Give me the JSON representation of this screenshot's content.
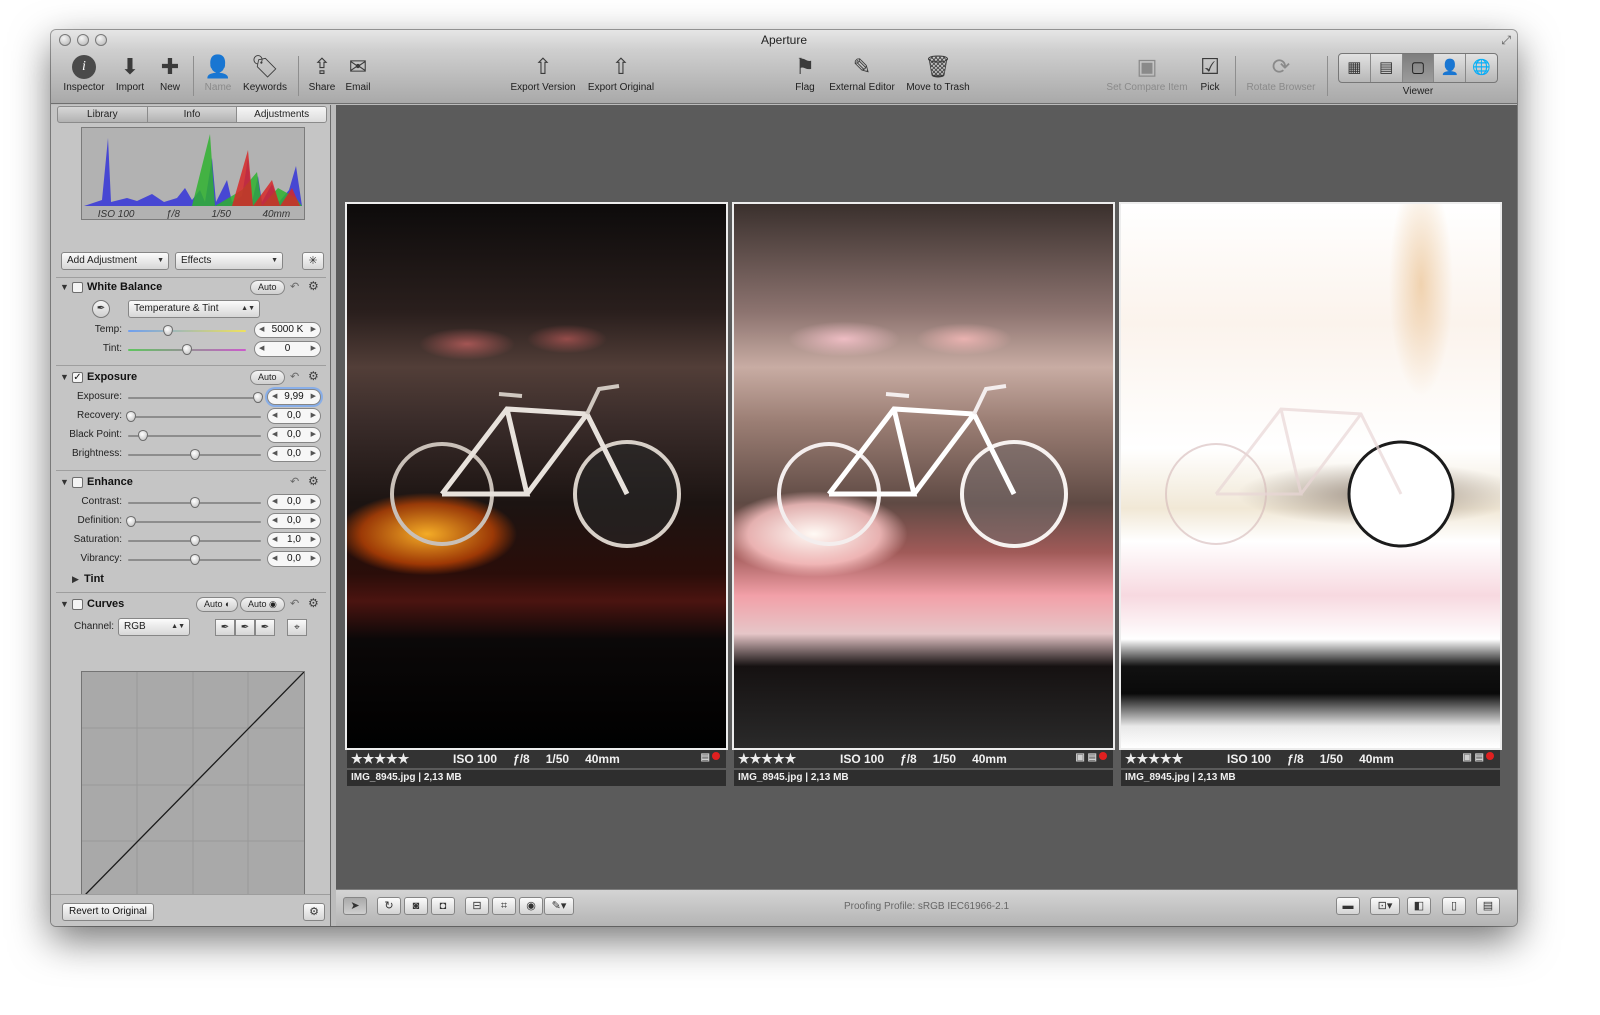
{
  "window": {
    "title": "Aperture"
  },
  "toolbar": {
    "inspector": "Inspector",
    "import": "Import",
    "new": "New",
    "name": "Name",
    "keywords": "Keywords",
    "share": "Share",
    "email": "Email",
    "export_version": "Export Version",
    "export_original": "Export Original",
    "flag": "Flag",
    "external_editor": "External Editor",
    "move_to_trash": "Move to Trash",
    "set_compare_item": "Set Compare Item",
    "pick": "Pick",
    "rotate_browser": "Rotate Browser",
    "viewer": "Viewer"
  },
  "inspector": {
    "tabs": [
      "Library",
      "Info",
      "Adjustments"
    ],
    "active_tab": "Adjustments",
    "histogram": {
      "iso": "ISO 100",
      "aperture": "ƒ/8",
      "shutter": "1/50",
      "focal": "40mm"
    },
    "add_adjustment": "Add Adjustment",
    "effects": "Effects",
    "white_balance": {
      "title": "White Balance",
      "enabled": false,
      "auto": "Auto",
      "mode": "Temperature & Tint",
      "temp_label": "Temp:",
      "temp_value": "5000 K",
      "tint_label": "Tint:",
      "tint_value": "0"
    },
    "exposure": {
      "title": "Exposure",
      "enabled": true,
      "auto": "Auto",
      "rows": [
        {
          "label": "Exposure:",
          "value": "9,99"
        },
        {
          "label": "Recovery:",
          "value": "0,0"
        },
        {
          "label": "Black Point:",
          "value": "0,0"
        },
        {
          "label": "Brightness:",
          "value": "0,0"
        }
      ]
    },
    "enhance": {
      "title": "Enhance",
      "enabled": false,
      "rows": [
        {
          "label": "Contrast:",
          "value": "0,0"
        },
        {
          "label": "Definition:",
          "value": "0,0"
        },
        {
          "label": "Saturation:",
          "value": "1,0"
        },
        {
          "label": "Vibrancy:",
          "value": "0,0"
        }
      ],
      "tint": "Tint"
    },
    "curves": {
      "title": "Curves",
      "enabled": false,
      "auto1": "Auto",
      "auto2": "Auto",
      "channel_label": "Channel:",
      "channel_value": "RGB"
    },
    "revert": "Revert to Original"
  },
  "images": [
    {
      "rating": "★★★★★",
      "iso": "ISO 100",
      "aperture": "ƒ/8",
      "shutter": "1/50",
      "focal": "40mm",
      "file": "IMG_8945.jpg",
      "size": "2,13 MB"
    },
    {
      "rating": "★★★★★",
      "iso": "ISO 100",
      "aperture": "ƒ/8",
      "shutter": "1/50",
      "focal": "40mm",
      "file": "IMG_8945.jpg",
      "size": "2,13 MB"
    },
    {
      "rating": "★★★★★",
      "iso": "ISO 100",
      "aperture": "ƒ/8",
      "shutter": "1/50",
      "focal": "40mm",
      "file": "IMG_8945.jpg",
      "size": "2,13 MB"
    }
  ],
  "viewer_footer": {
    "proofing": "Proofing Profile: sRGB IEC61966-2.1"
  },
  "colors": {
    "viewer_bg": "#5b5b5b",
    "focus_ring": "#88aee8",
    "reject_dot": "#e02020"
  }
}
